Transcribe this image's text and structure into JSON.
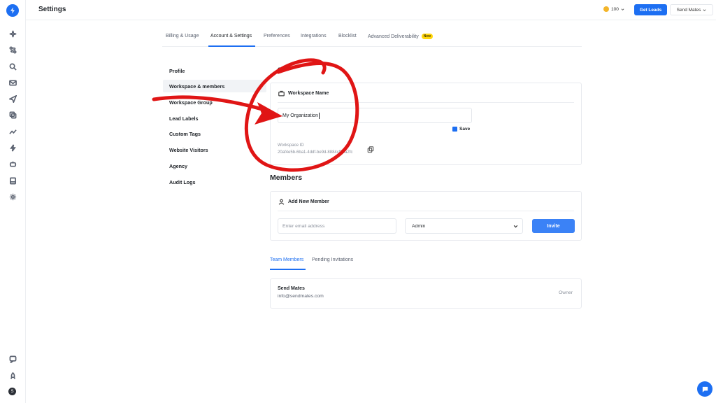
{
  "header": {
    "title": "Settings",
    "credits": "100",
    "get_leads": "Get Leads",
    "workspace_selector": "Send Mates"
  },
  "rail": {
    "icons": [
      "sparkle-icon",
      "route-icon",
      "search-icon",
      "mail-icon",
      "send-icon",
      "copy-icon",
      "trend-icon",
      "bolt-icon",
      "robot-icon",
      "inbox-icon",
      "gear-icon",
      "feedback-icon",
      "rocket-icon"
    ],
    "avatar_initial": "S"
  },
  "tabs": [
    {
      "label": "Billing & Usage"
    },
    {
      "label": "Account & Settings"
    },
    {
      "label": "Preferences"
    },
    {
      "label": "Integrations"
    },
    {
      "label": "Blocklist"
    },
    {
      "label": "Advanced Deliverability",
      "badge": "New"
    }
  ],
  "side_menu": [
    "Profile",
    "Workspace & members",
    "Workspace Group",
    "Lead Labels",
    "Custom Tags",
    "Website Visitors",
    "Agency",
    "Audit Logs"
  ],
  "workspace": {
    "section_title_partial": "orks",
    "card_title": "Workspace Name",
    "name_value": "My Organization",
    "save_label": "Save",
    "id_label": "Workspace ID",
    "id_value": "20af4e5b-6ba1-4ddf-be9d-8884cf00a2fc"
  },
  "members": {
    "title": "Members",
    "add_title": "Add New Member",
    "email_placeholder": "Enter email address",
    "role_value": "Admin",
    "invite_label": "Invite",
    "tabs": [
      "Team Members",
      "Pending Invitations"
    ],
    "list": [
      {
        "name": "Send Mates",
        "email": "info@sendmates.com",
        "role": "Owner"
      }
    ]
  },
  "colors": {
    "accent": "#1d6ff2",
    "annotation": "#e01515",
    "badge": "#ffd60a"
  }
}
